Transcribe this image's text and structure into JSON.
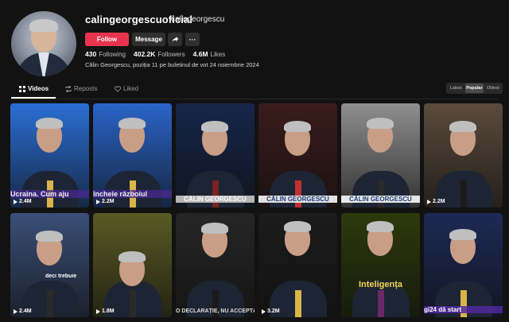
{
  "profile": {
    "username": "calingeorgescuoficial",
    "nickname": "calingeorgescu",
    "follow_label": "Follow",
    "message_label": "Message",
    "more_label": "···",
    "following_count": "430",
    "following_label": "Following",
    "followers_count": "402.2K",
    "followers_label": "Followers",
    "likes_count": "4.6M",
    "likes_label": "Likes",
    "bio": "Călin Georgescu, poziția 11 pe buletinul de vot 24 noiembrie 2024"
  },
  "tabs": [
    {
      "label": "Videos",
      "icon": "grid-icon"
    },
    {
      "label": "Reposts",
      "icon": "repost-icon"
    },
    {
      "label": "Liked",
      "icon": "heart-icon"
    }
  ],
  "sort": [
    "Latest",
    "Popular",
    "Oldest"
  ],
  "videos": [
    {
      "views": "2.4M",
      "caption": "Ucraina. Cum aju",
      "bg": "#2b6fd6"
    },
    {
      "views": "2.2M",
      "caption": "încheie războiul",
      "bg": "#2a64c8"
    },
    {
      "views": "",
      "caption": "CĂLIN GEORGESCU",
      "bg": "#16264a"
    },
    {
      "views": "",
      "caption": "CĂLIN GEORGESCU",
      "bg": "#3a1c1c"
    },
    {
      "views": "",
      "caption": "CĂLIN GEORGESCU",
      "bg": "#8f8f8f"
    },
    {
      "views": "2.2M",
      "caption": "",
      "bg": "#5b4b3c"
    },
    {
      "views": "2.4M",
      "caption": "deci trebuie",
      "bg": "#3a4f77"
    },
    {
      "views": "1.8M",
      "caption": "",
      "bg": "#5a5a24"
    },
    {
      "views": "",
      "caption": "O DECLARAȚIE, NU ACCEPTĂ",
      "bg": "#262626"
    },
    {
      "views": "3.2M",
      "caption": "",
      "bg": "#1c1c1c"
    },
    {
      "views": "",
      "caption": "Inteligența",
      "bg": "#2d3a0c"
    },
    {
      "views": "",
      "caption": "gi24 dă start",
      "bg": "#1d2a55"
    }
  ]
}
